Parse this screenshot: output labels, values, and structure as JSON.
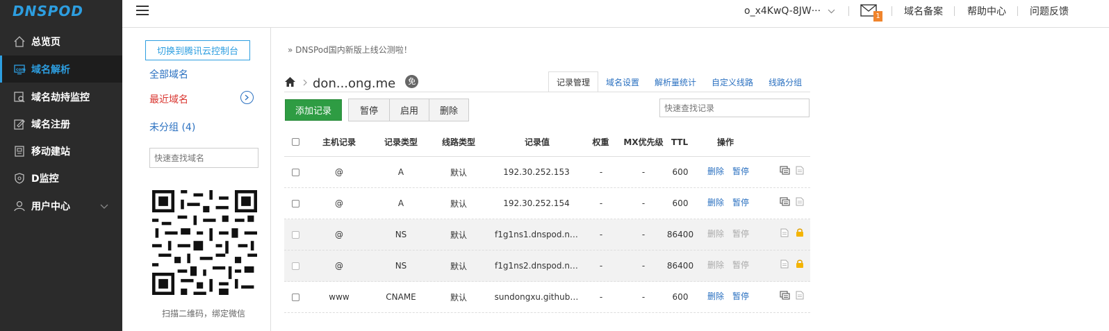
{
  "brand": {
    "logo": "DNSPOD",
    "accent": "#2d9ee0"
  },
  "sidebar": {
    "items": [
      {
        "label": "总览页",
        "icon": "home-icon"
      },
      {
        "label": "域名解析",
        "icon": "dns-icon",
        "active": true
      },
      {
        "label": "域名劫持监控",
        "icon": "monitor-icon"
      },
      {
        "label": "域名注册",
        "icon": "register-icon"
      },
      {
        "label": "移动建站",
        "icon": "mobile-site-icon"
      },
      {
        "label": "D监控",
        "icon": "shield-icon"
      },
      {
        "label": "用户中心",
        "icon": "user-icon"
      }
    ]
  },
  "topbar": {
    "username": "o_x4KwQ-8JW···",
    "mail_count": "1",
    "links": [
      "域名备案",
      "帮助中心",
      "问题反馈"
    ]
  },
  "domain_panel": {
    "switch_button": "切换到腾讯云控制台",
    "all_domains": "全部域名",
    "recent_domains": "最近域名",
    "ungrouped": "未分组 (4)",
    "search_placeholder": "快速查找域名",
    "qr_caption": "扫描二维码，绑定微信"
  },
  "main": {
    "notice": "» DNSPod国内新版上线公测啦！",
    "domain": "don...ong.me",
    "badge": "免",
    "tabs": [
      "记录管理",
      "域名设置",
      "解析量统计",
      "自定义线路",
      "线路分组"
    ],
    "add_button": "添加记录",
    "pause_button": "暂停",
    "enable_button": "启用",
    "delete_button": "删除",
    "search_placeholder": "快速查找记录"
  },
  "table": {
    "headers": [
      "主机记录",
      "记录类型",
      "线路类型",
      "记录值",
      "权重",
      "MX优先级",
      "TTL",
      "操作"
    ],
    "rows": [
      {
        "host": "@",
        "type": "A",
        "line": "默认",
        "value": "192.30.252.153",
        "weight": "-",
        "mx": "-",
        "ttl": "600",
        "del": "删除",
        "pause": "暂停",
        "locked": false
      },
      {
        "host": "@",
        "type": "A",
        "line": "默认",
        "value": "192.30.252.154",
        "weight": "-",
        "mx": "-",
        "ttl": "600",
        "del": "删除",
        "pause": "暂停",
        "locked": false
      },
      {
        "host": "@",
        "type": "NS",
        "line": "默认",
        "value": "f1g1ns1.dnspod.n…",
        "weight": "-",
        "mx": "-",
        "ttl": "86400",
        "del": "删除",
        "pause": "暂停",
        "locked": true
      },
      {
        "host": "@",
        "type": "NS",
        "line": "默认",
        "value": "f1g1ns2.dnspod.n…",
        "weight": "-",
        "mx": "-",
        "ttl": "86400",
        "del": "删除",
        "pause": "暂停",
        "locked": true
      },
      {
        "host": "www",
        "type": "CNAME",
        "line": "默认",
        "value": "sundongxu.github…",
        "weight": "-",
        "mx": "-",
        "ttl": "600",
        "del": "删除",
        "pause": "暂停",
        "locked": false
      }
    ]
  }
}
